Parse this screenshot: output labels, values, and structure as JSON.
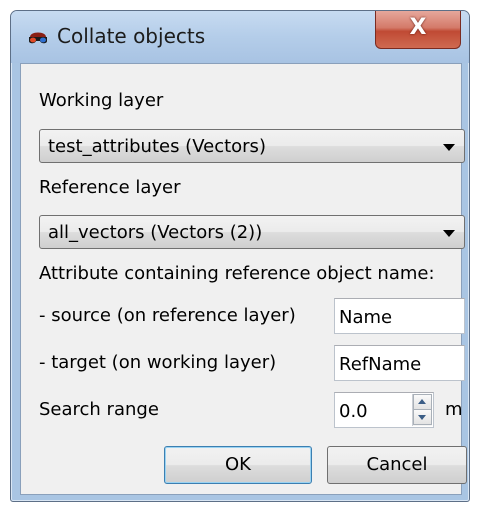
{
  "window": {
    "title": "Collate objects",
    "close_glyph": "X"
  },
  "working_layer": {
    "label": "Working layer",
    "selected": "test_attributes (Vectors)"
  },
  "reference_layer": {
    "label": "Reference layer",
    "selected": "all_vectors (Vectors (2))"
  },
  "attribute_section": {
    "label": "Attribute containing reference object name:"
  },
  "source": {
    "label": "- source (on reference layer)",
    "value": "Name"
  },
  "target": {
    "label": "- target (on working layer)",
    "value": "RefName"
  },
  "search_range": {
    "label": "Search range",
    "value": "0.0",
    "unit": "m"
  },
  "buttons": {
    "ok": "OK",
    "cancel": "Cancel"
  },
  "icons": {
    "app": "3d-glasses-icon",
    "close": "close-icon",
    "dropdown": "chevron-down-icon",
    "spin_up": "spin-up-icon",
    "spin_down": "spin-down-icon"
  },
  "colors": {
    "title_bar": "#b4cde9",
    "close_button": "#c04a34",
    "client_background": "#f0f0f0",
    "default_button_border": "#3c7fb1"
  }
}
